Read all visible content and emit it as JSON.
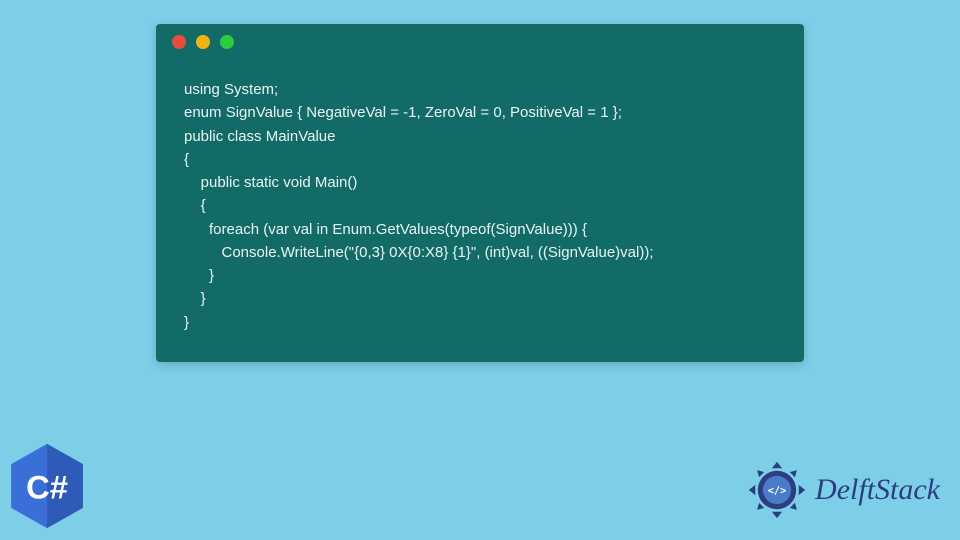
{
  "code": {
    "lines": [
      "using System;",
      "",
      "enum SignValue { NegativeVal = -1, ZeroVal = 0, PositiveVal = 1 };",
      "",
      "public class MainValue",
      "{",
      "    public static void Main()",
      "    {",
      "      foreach (var val in Enum.GetValues(typeof(SignValue))) {",
      "         Console.WriteLine(\"{0,3} 0X{0:X8} {1}\", (int)val, ((SignValue)val));",
      "      }",
      "    }",
      "}"
    ]
  },
  "badge": {
    "language": "C#"
  },
  "brand": {
    "name": "DelftStack"
  },
  "colors": {
    "background": "#7dcfe8",
    "code_window": "#136b68",
    "code_text": "#e8f5f4",
    "dot_red": "#e74c3c",
    "dot_yellow": "#f1b40f",
    "dot_green": "#2ecc40",
    "csharp_badge": "#3a6fd8",
    "brand_text": "#2c3e80"
  }
}
